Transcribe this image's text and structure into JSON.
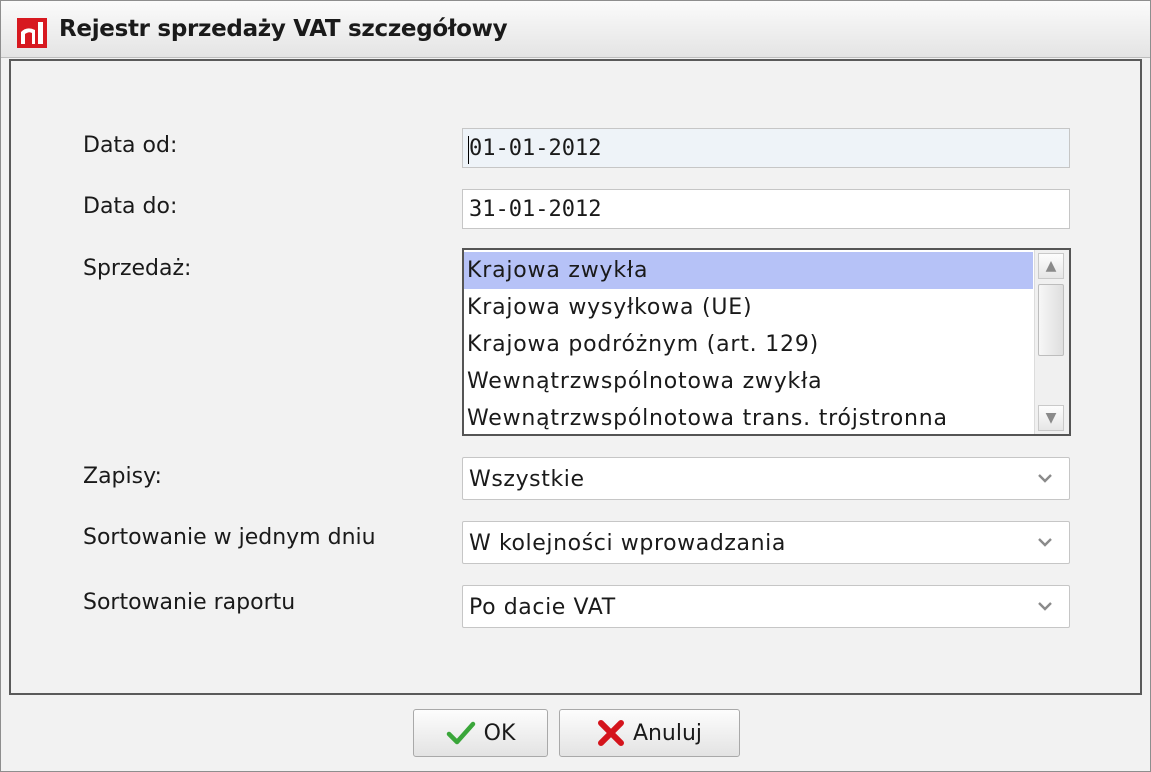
{
  "window": {
    "title": "Rejestr sprzedaży VAT szczegółowy",
    "logo_icon": "app-logo-icon",
    "accent_color": "#d71920"
  },
  "form": {
    "date_from": {
      "label": "Data od:",
      "value": "01-01-2012"
    },
    "date_to": {
      "label": "Data do:",
      "value": "31-01-2012"
    },
    "sales": {
      "label": "Sprzedaż:",
      "items": [
        "Krajowa zwykła",
        "Krajowa wysyłkowa (UE)",
        "Krajowa podróżnym (art. 129)",
        "Wewnątrzwspólnotowa zwykła",
        "Wewnątrzwspólnotowa trans. trójstronna"
      ],
      "selected_index": 0,
      "selected_color": "#b6c2f7"
    },
    "entries": {
      "label": "Zapisy:",
      "value": "Wszystkie"
    },
    "sort_day": {
      "label": "Sortowanie w jednym dniu",
      "value": "W kolejności wprowadzania"
    },
    "sort_report": {
      "label": "Sortowanie raportu",
      "value": "Po dacie VAT"
    }
  },
  "buttons": {
    "ok": {
      "label": "OK",
      "icon": "checkmark-icon",
      "icon_color": "#3aa63a"
    },
    "cancel": {
      "label": "Anuluj",
      "icon": "x-icon",
      "icon_color": "#d4141c"
    }
  }
}
